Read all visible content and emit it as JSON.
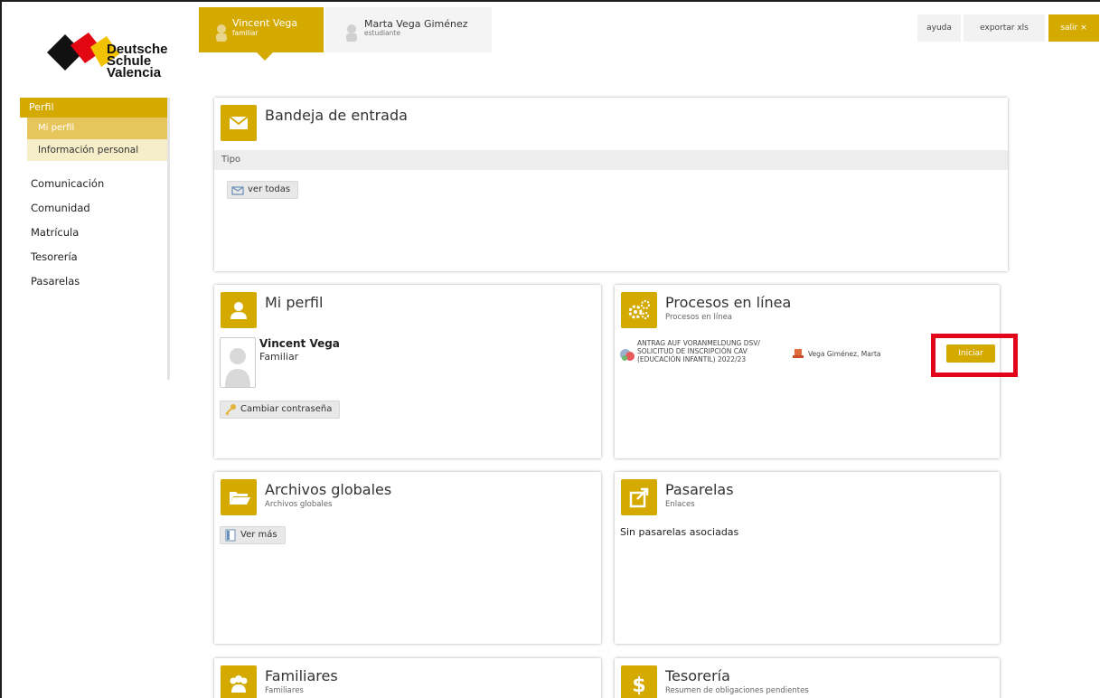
{
  "logo": {
    "line1": "Deutsche",
    "line2": "Schule",
    "line3": "Valencia"
  },
  "tabs": [
    {
      "name": "Vincent Vega",
      "role": "familiar"
    },
    {
      "name": "Marta Vega Giménez",
      "role": "estudiante"
    }
  ],
  "top_buttons": {
    "ayuda": "ayuda",
    "exportar": "exportar xls",
    "salir": "salir ×"
  },
  "sidebar": {
    "header": "Perfil",
    "sub_active": "Mi perfil",
    "sub_item": "Información personal",
    "items": [
      "Comunicación",
      "Comunidad",
      "Matrícula",
      "Tesorería",
      "Pasarelas"
    ]
  },
  "panels": {
    "inbox": {
      "title": "Bandeja de entrada",
      "tipo": "Tipo",
      "ver_todas": "ver todas"
    },
    "perfil": {
      "title": "Mi perfil",
      "name": "Vincent Vega",
      "role": "Familiar",
      "cambiar": "Cambiar contraseña"
    },
    "procesos": {
      "title": "Procesos en línea",
      "subtitle": "Procesos en línea",
      "process_text": "ANTRAG AUF VORANMELDUNG DSV/ SOLICITUD DE INSCRIPCIÓN CAV (EDUCACIÓN INFANTIL) 2022/23",
      "user": "Vega Giménez, Marta",
      "iniciar": "Iniciar"
    },
    "archivos": {
      "title": "Archivos globales",
      "subtitle": "Archivos globales",
      "ver_mas": "Ver más"
    },
    "pasarelas": {
      "title": "Pasarelas",
      "subtitle": "Enlaces",
      "empty": "Sin pasarelas asociadas"
    },
    "familiares": {
      "title": "Familiares",
      "subtitle": "Familiares"
    },
    "tesoreria": {
      "title": "Tesorería",
      "subtitle": "Resumen de obligaciones pendientes"
    }
  },
  "colors": {
    "accent": "#d4a900",
    "highlight": "#e3061b"
  }
}
